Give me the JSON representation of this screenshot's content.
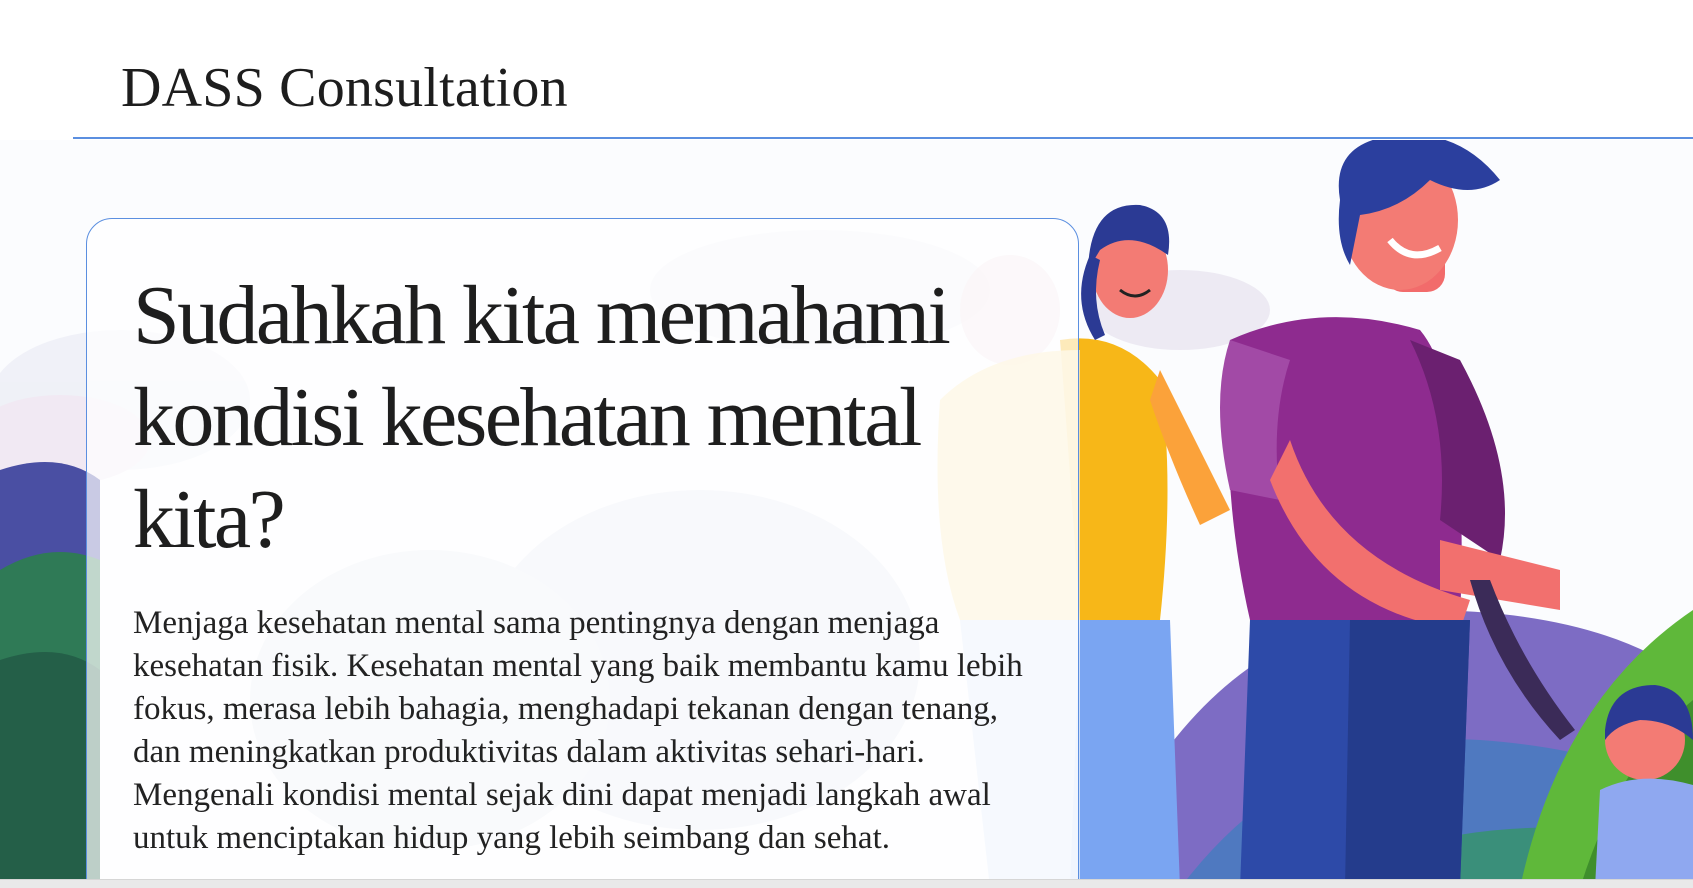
{
  "header": {
    "brand": "DASS Consultation"
  },
  "hero": {
    "title": "Sudahkah kita memahami kondisi kesehatan mental kita?",
    "body": "Menjaga kesehatan mental sama pentingnya dengan menjaga kesehatan fisik. Kesehatan mental yang baik membantu kamu lebih fokus, merasa lebih bahagia, menghadapi tekanan dengan tenang, dan meningkatkan produktivitas dalam aktivitas sehari-hari. Mengenali kondisi mental sejak dini dapat menjadi langkah awal untuk menciptakan hidup yang lebih seimbang dan sehat."
  },
  "illustration": {
    "name": "family-walking-illustration",
    "colors": {
      "accent_border": "#5b8fe0",
      "hill_purple": "#5c4aa8",
      "hill_green": "#2f8a5a",
      "shirt_yellow": "#f5b400",
      "shirt_purple": "#8e2b8f",
      "skin": "#f26b6b",
      "hair_blue": "#2b3f9e",
      "leaf_green": "#5fb83a"
    }
  }
}
